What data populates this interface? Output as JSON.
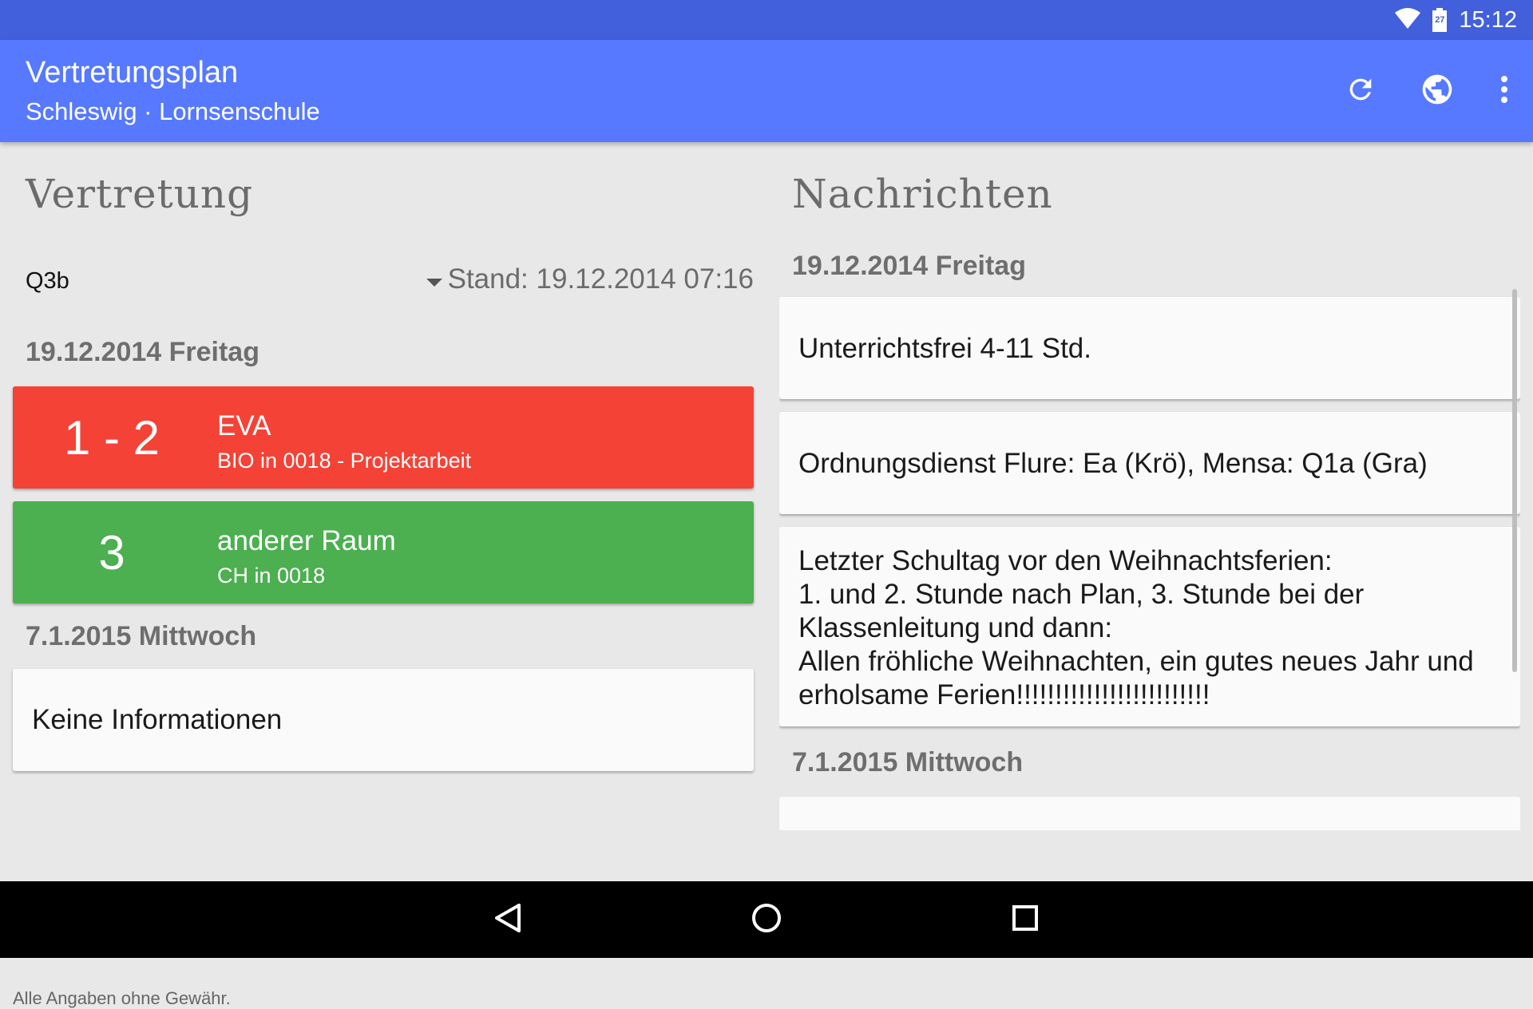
{
  "status_bar": {
    "battery_level": "27",
    "time": "15:12"
  },
  "app_bar": {
    "title": "Vertretungsplan",
    "subtitle": "Schleswig · Lornsenschule",
    "actions": [
      "refresh-icon",
      "globe-icon",
      "more-vert-icon"
    ]
  },
  "substitution": {
    "heading": "Vertretung",
    "class_selected": "Q3b",
    "stand": "Stand: 19.12.2014 07:16",
    "days": [
      {
        "header": "19.12.2014 Freitag",
        "entries": [
          {
            "lesson": "1 - 2",
            "title": "EVA",
            "detail": "BIO in 0018 - Projektarbeit",
            "color": "#f44236"
          },
          {
            "lesson": "3",
            "title": "anderer Raum",
            "detail": "CH in 0018",
            "color": "#4caf50"
          }
        ]
      },
      {
        "header": "7.1.2015 Mittwoch",
        "info": "Keine Informationen"
      }
    ],
    "disclaimer": "Alle Angaben ohne Gewähr."
  },
  "messages": {
    "heading": "Nachrichten",
    "days": [
      {
        "header": "19.12.2014 Freitag",
        "items": [
          {
            "lines": [
              "Unterrichtsfrei 4-11 Std."
            ]
          },
          {
            "lines": [
              "Ordnungsdienst Flure: Ea (Krö), Mensa: Q1a (Gra)"
            ]
          },
          {
            "lines": [
              "Letzter Schultag vor den Weihnachtsferien:",
              "1. und 2. Stunde nach Plan, 3. Stunde bei der",
              "Klassenleitung und dann:",
              "Allen fröhliche Weihnachten, ein gutes neues Jahr und",
              "erholsame Ferien!!!!!!!!!!!!!!!!!!!!!!!!!"
            ]
          }
        ]
      },
      {
        "header": "7.1.2015 Mittwoch",
        "items": []
      }
    ]
  },
  "colors": {
    "status_bar": "#4260db",
    "app_bar": "#5779ff",
    "background": "#e8e8e8",
    "card_red": "#f44236",
    "card_green": "#4caf50"
  },
  "nav_bar": [
    "back-icon",
    "home-icon",
    "recents-icon"
  ]
}
